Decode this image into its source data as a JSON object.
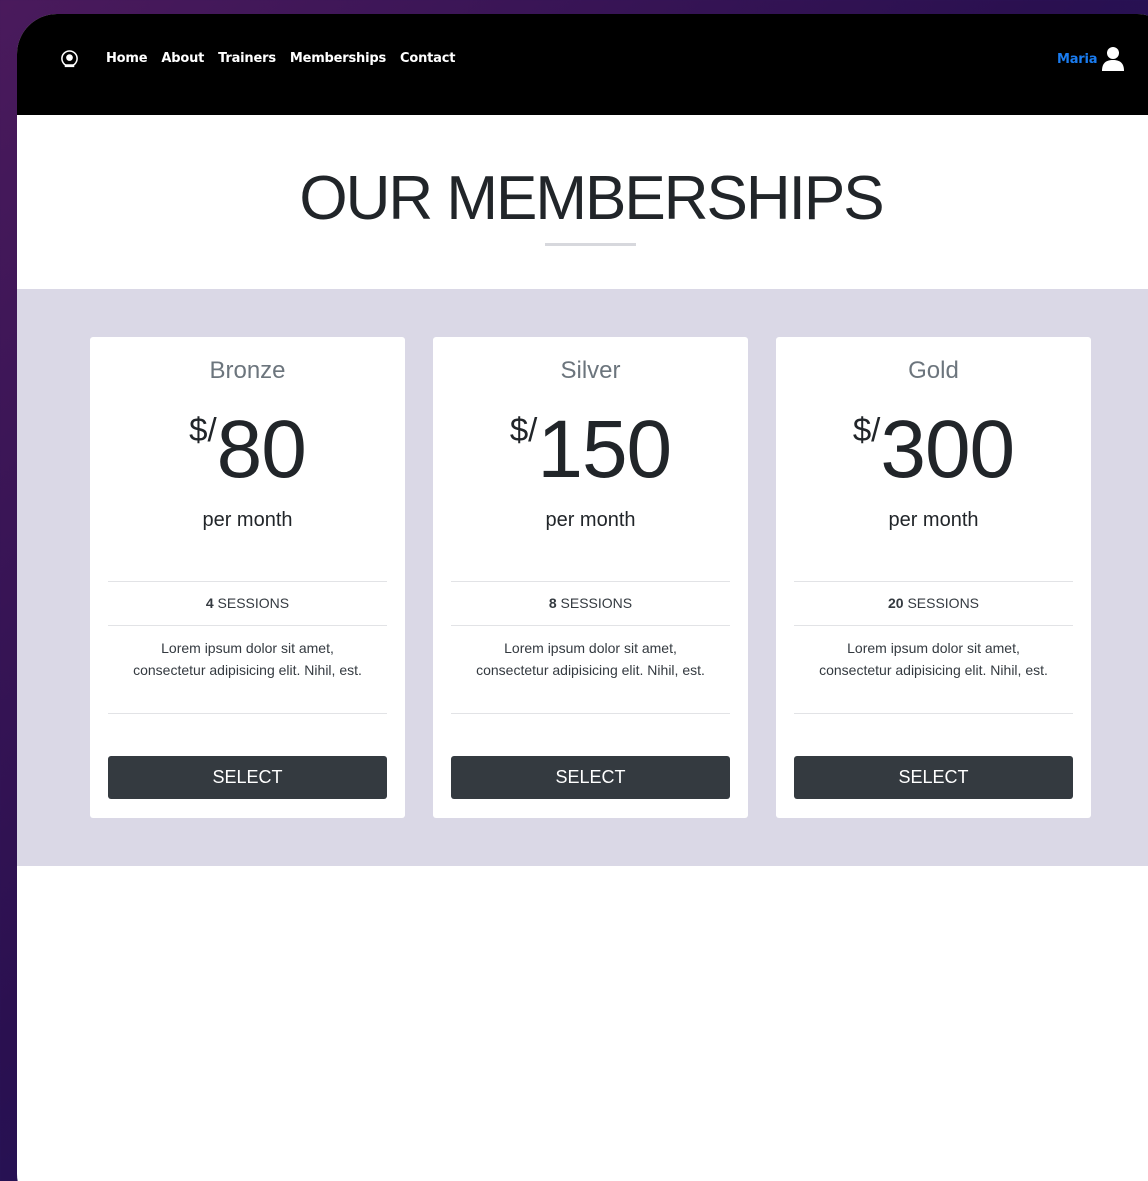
{
  "nav": {
    "links": [
      "Home",
      "About",
      "Trainers",
      "Memberships",
      "Contact"
    ],
    "user_name": "Maria",
    "logo_icon": "gym-logo-icon",
    "user_icon": "user-icon"
  },
  "page": {
    "title": "OUR MEMBERSHIPS"
  },
  "plans": [
    {
      "name": "Bronze",
      "currency": "$/",
      "amount": "80",
      "period": "per month",
      "sessions_count": "4",
      "sessions_label": "SESSIONS",
      "description": "Lorem ipsum dolor sit amet, consectetur adipisicing elit. Nihil, est.",
      "button": "SELECT"
    },
    {
      "name": "Silver",
      "currency": "$/",
      "amount": "150",
      "period": "per month",
      "sessions_count": "8",
      "sessions_label": "SESSIONS",
      "description": "Lorem ipsum dolor sit amet, consectetur adipisicing elit. Nihil, est.",
      "button": "SELECT"
    },
    {
      "name": "Gold",
      "currency": "$/",
      "amount": "300",
      "period": "per month",
      "sessions_count": "20",
      "sessions_label": "SESSIONS",
      "description": "Lorem ipsum dolor sit amet, consectetur adipisicing elit. Nihil, est.",
      "button": "SELECT"
    }
  ],
  "colors": {
    "navbar_bg": "#000000",
    "user_name": "#1a7cf0",
    "pricing_band": "#dad8e6",
    "button_bg": "#343a40"
  }
}
